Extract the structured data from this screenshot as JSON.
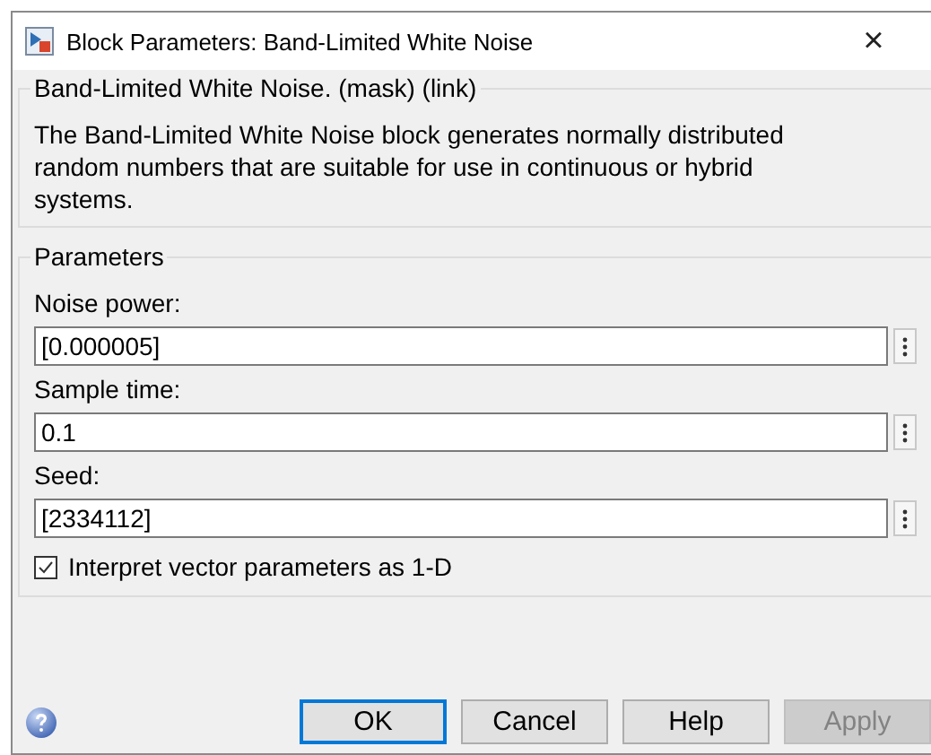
{
  "window": {
    "title": "Block Parameters: Band-Limited White Noise",
    "close": "×"
  },
  "description_group": {
    "title": "Band-Limited White Noise. (mask) (link)",
    "text": "The Band-Limited White Noise block generates normally distributed random numbers that are suitable for use in continuous or hybrid systems."
  },
  "parameters_group": {
    "title": "Parameters",
    "fields": [
      {
        "label": "Noise power:",
        "value": "[0.000005]"
      },
      {
        "label": "Sample time:",
        "value": "0.1"
      },
      {
        "label": "Seed:",
        "value": "[2334112]"
      }
    ],
    "checkbox": {
      "label": "Interpret vector parameters as 1-D",
      "checked": true
    }
  },
  "buttons": [
    {
      "label": "OK",
      "default": true,
      "disabled": false
    },
    {
      "label": "Cancel",
      "default": false,
      "disabled": false
    },
    {
      "label": "Help",
      "default": false,
      "disabled": false
    },
    {
      "label": "Apply",
      "default": false,
      "disabled": true
    }
  ]
}
